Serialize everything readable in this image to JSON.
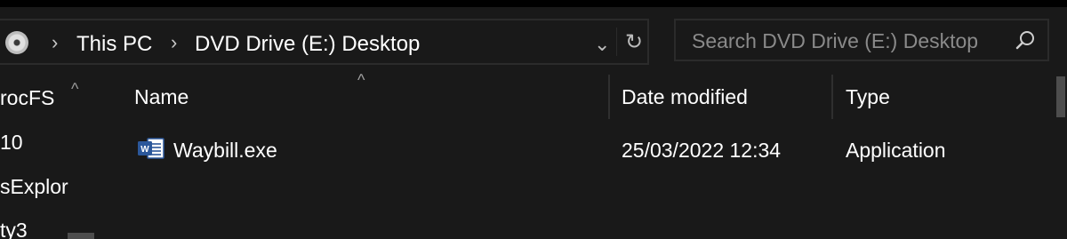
{
  "address": {
    "breadcrumb": [
      {
        "label": "This PC"
      },
      {
        "label": "DVD Drive (E:) Desktop"
      }
    ],
    "separator": "›",
    "dropdown_glyph": "⌄",
    "refresh_glyph": "↻"
  },
  "search": {
    "placeholder": "Search DVD Drive (E:) Desktop",
    "icon": "search-icon"
  },
  "nav": {
    "items": [
      {
        "label": "rocFS"
      },
      {
        "label": "10"
      },
      {
        "label": "sExplor"
      },
      {
        "label": "ty3"
      }
    ],
    "scroll_up_glyph": "^"
  },
  "columns": {
    "name": "Name",
    "date": "Date modified",
    "type": "Type",
    "sort_glyph": "^"
  },
  "files": [
    {
      "name": "Waybill.exe",
      "date_modified": "25/03/2022 12:34",
      "type": "Application",
      "icon": "word-document-icon"
    }
  ],
  "colors": {
    "background": "#191919",
    "border": "#2b2b2b",
    "text": "#ffffff",
    "muted_text": "#8a8a8a",
    "word_blue": "#2b579a"
  }
}
